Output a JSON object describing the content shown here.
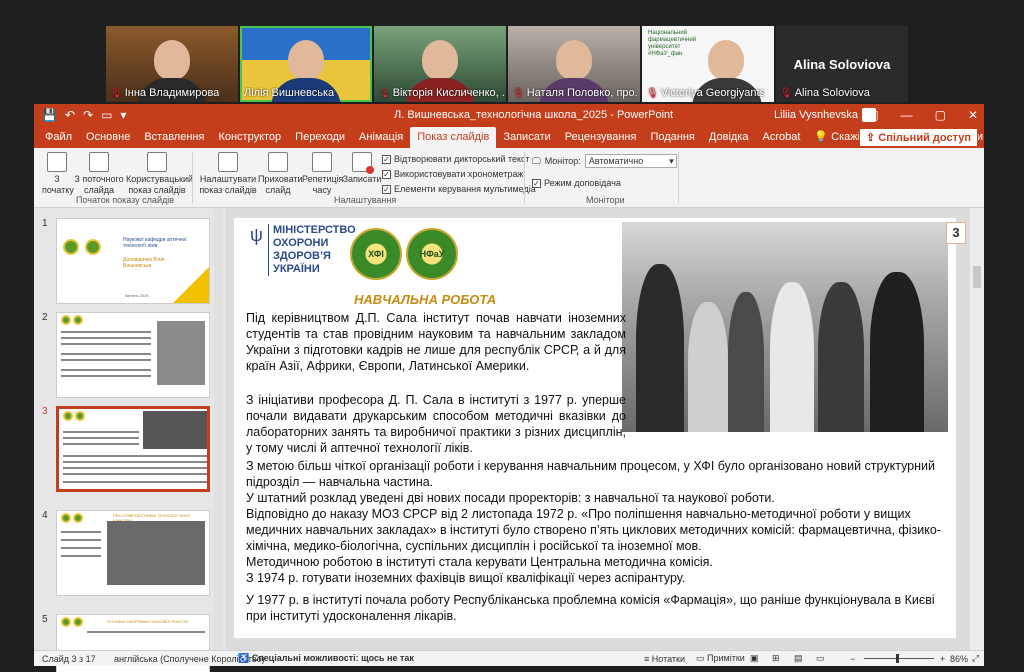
{
  "video": {
    "tiles": [
      {
        "name": "Інна Владимирова",
        "mic_off": true
      },
      {
        "name": "Лілія Вишневська",
        "mic_off": false
      },
      {
        "name": "Вікторія Кисличенко, ...",
        "mic_off": true
      },
      {
        "name": "Наталя Половко, про...",
        "mic_off": true
      },
      {
        "name": "Victoriya Georgiyants",
        "mic_off": true
      },
      {
        "name": "Alina Soloviova",
        "mic_off": true,
        "big_name": "Alina Soloviova"
      }
    ],
    "logo_text": "Національний фармацевтичний університет #НФаУ_фан"
  },
  "window": {
    "title": "Л. Вишневська_технологічна школа_2025 - PowerPoint",
    "user": "Liliia Vysnhevska"
  },
  "menu": {
    "tabs": [
      "Файл",
      "Основне",
      "Вставлення",
      "Конструктор",
      "Переходи",
      "Анімація",
      "Показ слайдів",
      "Записати",
      "Рецензування",
      "Подання",
      "Довідка",
      "Acrobat"
    ],
    "selected": "Показ слайдів",
    "tell_me": "Скажіть, що потрібно зробити",
    "share": "Спільний доступ"
  },
  "ribbon": {
    "btn_from_start": "З початку",
    "btn_from_current": "З поточного слайда",
    "btn_custom": "Користувацький показ слайдів",
    "group_start": "Початок показу слайдів",
    "btn_setup": "Налаштувати показ слайдів",
    "btn_hide": "Приховати слайд",
    "btn_rehearse": "Репетиція часу",
    "btn_record": "Записати",
    "chk_narration": "Відтворювати дикторський текст",
    "chk_timings": "Використовувати хронометраж",
    "chk_media": "Елементи керування мультимедіа",
    "group_setup": "Налаштування",
    "monitor_label": "Монітор:",
    "monitor_value": "Автоматично",
    "chk_presenter": "Режим доповідача",
    "group_monitors": "Монітори"
  },
  "thumbnails": {
    "numbers": [
      "1",
      "2",
      "3",
      "4",
      "5"
    ],
    "selected": "3",
    "t1_title": "Наукової кафедри аптечної технології ліків",
    "t1_author": "Доповідачка Лілія Вишневська",
    "t1_date": "Квітень 2025",
    "t4_title": "ПРО СПІВРОБІТНИКІВ ТЕХНОЛОГІЧНОЇ КАФЕДРИ",
    "t5_title": "ОСНОВНІ НАПРЯМКИ НАУКОВОЇ РОБОТИ"
  },
  "slide": {
    "number": "3",
    "ministry": [
      "МІНІСТЕРСТВО",
      "ОХОРОНИ",
      "ЗДОРОВ’Я",
      "УКРАЇНИ"
    ],
    "emblem1": "ХФІ",
    "emblem2": "НФаУ",
    "heading": "НАВЧАЛЬНА РОБОТА",
    "p1": "Під керівництвом Д.П. Сала інститут почав навчати іноземних студентів та став провідним науковим та навчальним закладом України з підготовки кадрів не лише для республік СРСР, а й для країн Азії, Африки, Європи, Латинської Америки.",
    "p2": "З ініціативи професора Д. П. Сала в інституті з 1977 р. уперше почали видавати друкарським способом методичні вказівки до лабораторних занять та виробничої практики з різних дисциплін, у тому числі й аптечної технології ліків.",
    "p3": "З метою більш чіткої організації роботи і керування навчальним процесом, у ХФІ було організовано новий структурний підрозділ — навчальна частина.",
    "p4": "У штатний розклад уведені дві нових посади проректорів: з навчальної та наукової роботи.",
    "p5": "Відповідно до наказу МОЗ СРСР від 2 листопада 1972 р. «Про поліпшення навчально-методичної роботи у вищих медичних навчальних закладах» в інституті було створено п’ять циклових методичних комісій: фармацевтична, фізико-хімічна, медико-біологічна, суспільних дисциплін і російської та іноземної мов.",
    "p6": "Методичною роботою в інституті стала керувати Центральна методична комісія.",
    "p7": "З 1974 р. готувати іноземних фахівців вищої кваліфікації через аспірантуру.",
    "p8": "У 1977 р. в інституті почала роботу Республіканська проблемна комісія «Фармація», що раніше функціонувала в Києві при інституті удосконалення лікарів."
  },
  "status": {
    "slide_of": "Слайд 3 з 17",
    "language": "англійська (Сполучене Королівство)",
    "accessibility": "Спеціальні можливості: щось не так",
    "notes": "Нотатки",
    "comments": "Примітки",
    "zoom": "86%"
  },
  "colors": {
    "accent": "#c43e1c",
    "heading": "#c78a10",
    "ministry": "#2c4a8a"
  }
}
